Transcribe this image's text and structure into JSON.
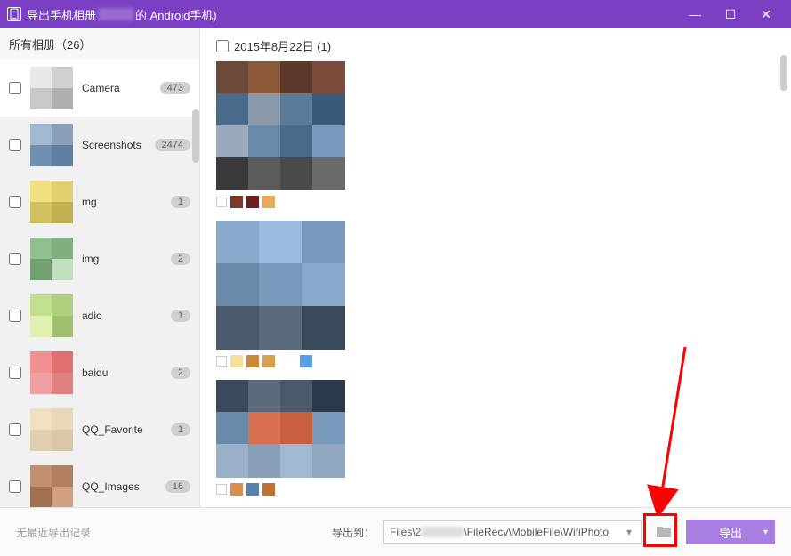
{
  "title": {
    "prefix": "导出手机相册",
    "suffix": "的 Android手机)"
  },
  "sidebar": {
    "header_prefix": "所有相册（",
    "header_count": "26",
    "header_suffix": "）",
    "albums": [
      {
        "name": "Camera",
        "count": "473",
        "selected": true
      },
      {
        "name": "Screenshots",
        "count": "2474"
      },
      {
        "name": "mg",
        "count": "1"
      },
      {
        "name": "img",
        "count": "2"
      },
      {
        "name": "adio",
        "count": "1"
      },
      {
        "name": "baidu",
        "count": "2"
      },
      {
        "name": "QQ_Favorite",
        "count": "1"
      },
      {
        "name": "QQ_Images",
        "count": "16"
      }
    ]
  },
  "main": {
    "date_label": "2015年8月22日 (1)"
  },
  "footer": {
    "recent_label": "无最近导出记录",
    "export_to_label": "导出到：",
    "path_prefix": "Files\\2",
    "path_suffix": "\\FileRecv\\MobileFile\\WifiPhoto",
    "export_button": "导出"
  },
  "colors": {
    "strip1": [
      "#7a3a2c",
      "#6b1f1f",
      "#e8a95a"
    ],
    "strip2": [
      "#f5e0a0",
      "#c98a3a",
      "#d8a050",
      "#5aa0e0"
    ],
    "strip3": [
      "#d89050",
      "#5a80b0",
      "#c07030"
    ]
  }
}
